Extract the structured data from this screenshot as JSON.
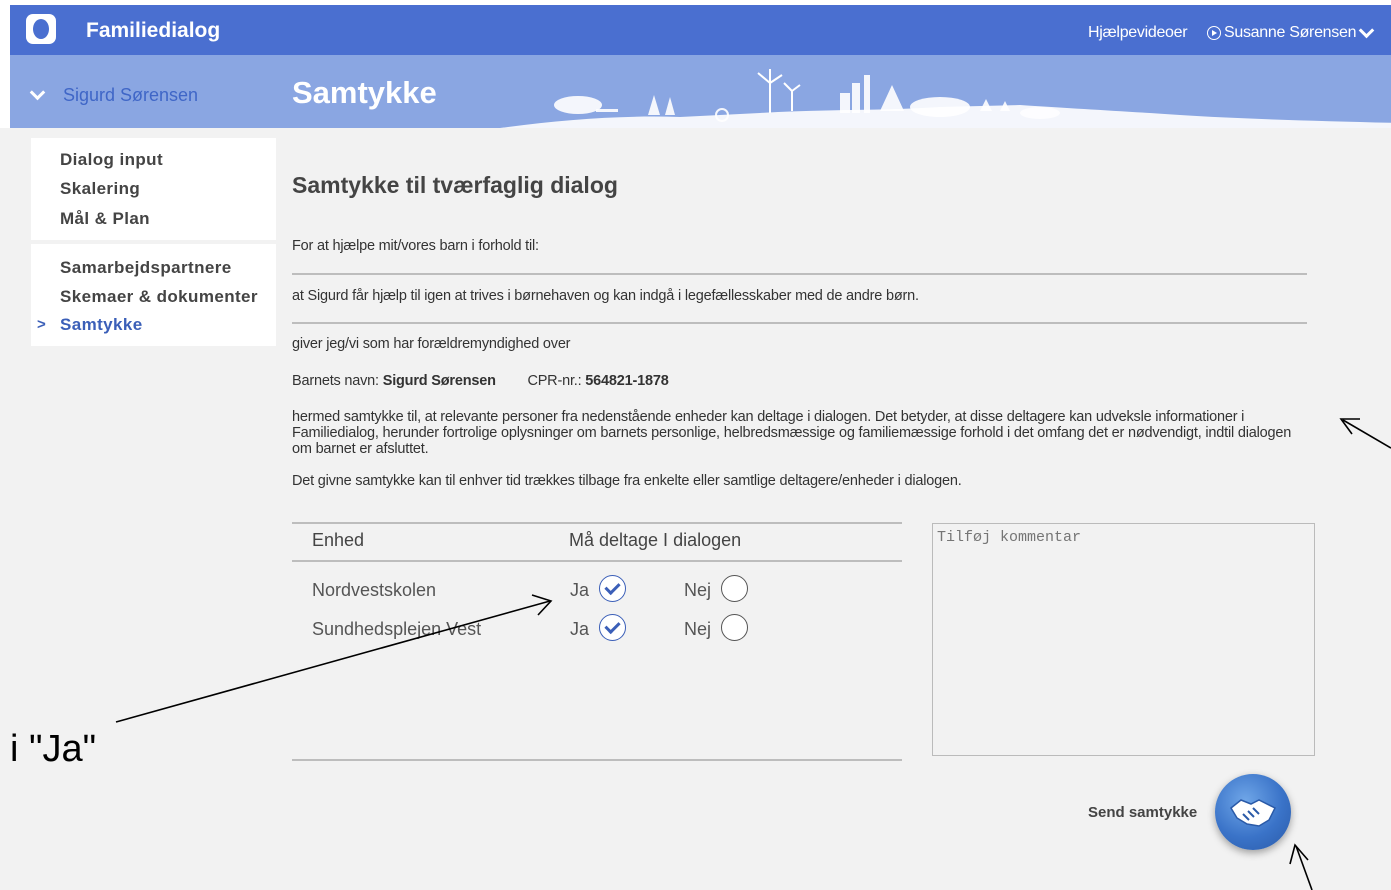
{
  "header": {
    "app_title": "Familiedialog",
    "help_link": "Hjælpevideoer",
    "user_name": "Susanne Sørensen",
    "brand_color": "#4a6fd0"
  },
  "subheader": {
    "selected_person": "Sigurd Sørensen",
    "page_title": "Samtykke"
  },
  "sidebar": {
    "group1": [
      "Dialog input",
      "Skalering",
      "Mål & Plan"
    ],
    "group2": [
      "Samarbejdspartnere",
      "Skemaer & dokumenter",
      "Samtykke"
    ],
    "active_item": "Samtykke"
  },
  "form": {
    "title": "Samtykke til tværfaglig dialog",
    "intro": "For at hjælpe mit/vores barn i forhold til:",
    "goal": "at Sigurd får hjælp til igen at trives i børnehaven og kan indgå i legefællesskaber med de andre børn.",
    "authority": "giver jeg/vi som har forældremyndighed over",
    "child_name_label": "Barnets navn:",
    "child_name": "Sigurd Sørensen",
    "cpr_label": "CPR-nr.:",
    "cpr": "564821-1878",
    "consent_text": "hermed samtykke til, at relevante personer fra nedenstående enheder kan deltage i dialogen. Det betyder, at disse deltagere kan udveksle informationer i Familiedialog, herunder fortrolige oplysninger om barnets personlige, helbredsmæssige og familiemæssige forhold i det omfang det er nødvendigt, indtil dialogen om barnet er afsluttet.",
    "withdraw_text": "Det givne samtykke kan til enhver tid trækkes tilbage fra enkelte eller samtlige deltagere/enheder i dialogen.",
    "table": {
      "col_unit": "Enhed",
      "col_permission": "Må deltage I dialogen",
      "yes_label": "Ja",
      "no_label": "Nej",
      "rows": [
        {
          "unit": "Nordvestskolen",
          "selected": "Ja"
        },
        {
          "unit": "Sundhedsplejen Vest",
          "selected": "Ja"
        }
      ]
    },
    "comment_placeholder": "Tilføj kommentar",
    "send_label": "Send samtykke"
  },
  "annotation": {
    "text": "i \"Ja\""
  }
}
